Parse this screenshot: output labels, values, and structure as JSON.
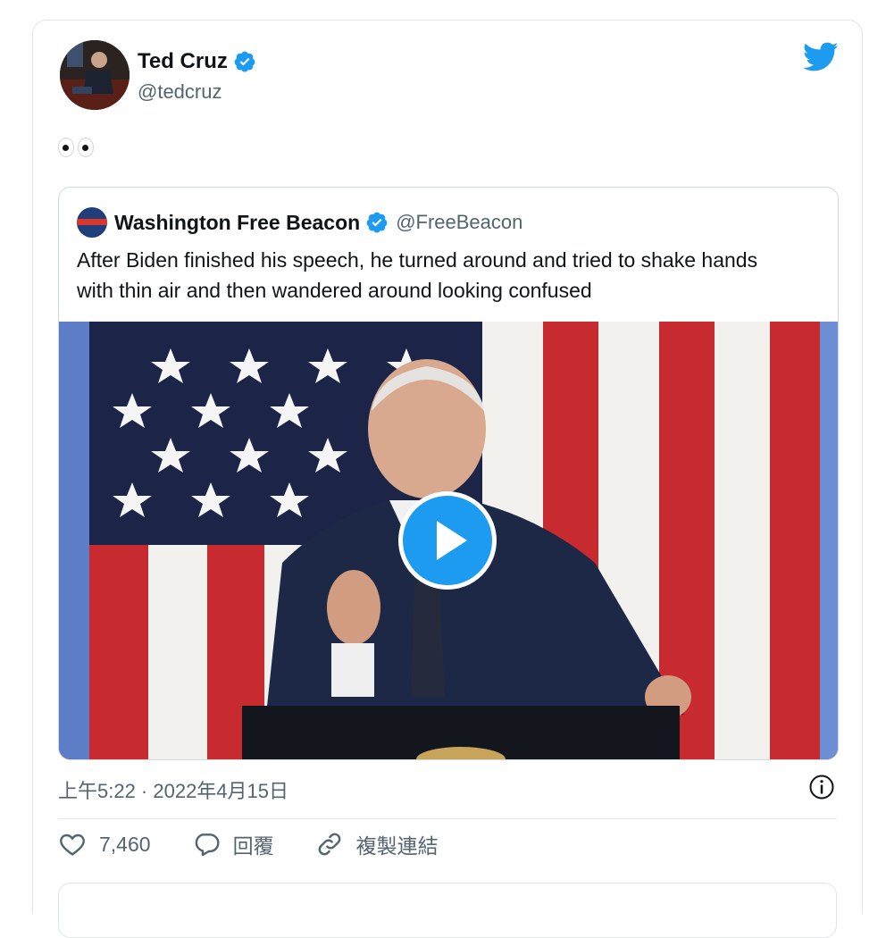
{
  "tweet": {
    "author_name": "Ted Cruz",
    "author_handle": "@tedcruz",
    "text": "👀",
    "timestamp": "上午5:22 · 2022年4月15日"
  },
  "quote": {
    "author_name": "Washington Free Beacon",
    "author_handle": "@FreeBeacon",
    "text": "After Biden finished his speech, he turned around and tried to shake hands with thin air and then wandered around looking confused"
  },
  "actions": {
    "likes": "7,460",
    "reply_label": "回覆",
    "copy_link_label": "複製連結"
  },
  "colors": {
    "accent": "#1d9bf0",
    "secondary_text": "#536471",
    "border": "#cfd9de"
  },
  "icons": [
    "verified-badge-icon",
    "twitter-bird-icon",
    "play-icon",
    "info-icon",
    "heart-icon",
    "reply-icon",
    "link-icon"
  ]
}
